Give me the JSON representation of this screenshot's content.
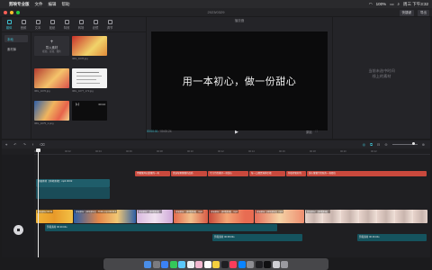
{
  "menu": {
    "app_name": "剪映专业版",
    "items": [
      "文件",
      "编辑",
      "帮助"
    ],
    "status_battery": "100%",
    "status_time": "周三 下午3:32"
  },
  "window": {
    "title": "2023/0329",
    "shortcut_label": "快捷键",
    "export_label": "导出"
  },
  "media": {
    "tabs": [
      {
        "label": "媒体",
        "icon": "media-icon"
      },
      {
        "label": "音频",
        "icon": "audio-icon"
      },
      {
        "label": "文本",
        "icon": "text-icon"
      },
      {
        "label": "贴纸",
        "icon": "sticker-icon"
      },
      {
        "label": "特效",
        "icon": "effects-icon"
      },
      {
        "label": "转场",
        "icon": "transition-icon"
      },
      {
        "label": "滤镜",
        "icon": "filter-icon"
      },
      {
        "label": "调节",
        "icon": "adjust-icon"
      }
    ],
    "sidebar": [
      "本地",
      "素材库"
    ],
    "import_label": "导入素材",
    "import_hint": "视频、音频、图片",
    "cards": [
      {
        "caption": "",
        "duration": ""
      },
      {
        "caption": "IMG_1078.jpg",
        "duration": ""
      },
      {
        "caption": "IMG_1076.jpg",
        "duration": ""
      },
      {
        "caption": "IMG_1077_172.jpg",
        "duration": ""
      },
      {
        "caption": "IMG_1075_1.png",
        "duration": ""
      },
      {
        "caption": "【1】",
        "duration": "00:24"
      }
    ]
  },
  "player": {
    "title": "播放器",
    "subtitle": "用一本初心，做一份甜心",
    "current_time": "00:00:01",
    "total_time": "00:00:24",
    "right_labels": [
      "原始",
      "比例"
    ]
  },
  "properties": {
    "empty_text_line1": "当前未选中时间",
    "empty_text_line2": "线上的素材"
  },
  "timeline": {
    "ticks": [
      "00:00",
      "00:02",
      "00:04",
      "00:06",
      "00:08",
      "00:10",
      "00:12",
      "00:14",
      "00:16",
      "00:18",
      "00:20",
      "00:22"
    ],
    "text_track": [
      "用薯薯开启甜蜜的一天",
      "优选每颗薯薯的品质",
      "专注为您做好一份甜心",
      "每一口都是满满幸福",
      "你值得更好的",
      "甜心薯薯为您服务一直都在"
    ],
    "sticker_track": [
      "剪辑素材 【本地素材】.mp4  00:02",
      "",
      "",
      ""
    ],
    "video_clips": [
      "剪辑素材 00:02",
      "剪辑素材【本地素材】-TCZG.mp4 00:00.2",
      "剪辑素材 【本地素材】",
      "剪辑素材 【本地素材】.mp4",
      "剪辑素材 【本地素材】.mp4",
      "剪辑素材【本地素材】.mp4",
      "剪辑素材 【本地素材】"
    ],
    "audio_1": "剪辑素材 00:20.04s",
    "audio_2": "剪辑素材 00:08.03s",
    "audio_3": "剪辑素材 00:16.04s"
  }
}
